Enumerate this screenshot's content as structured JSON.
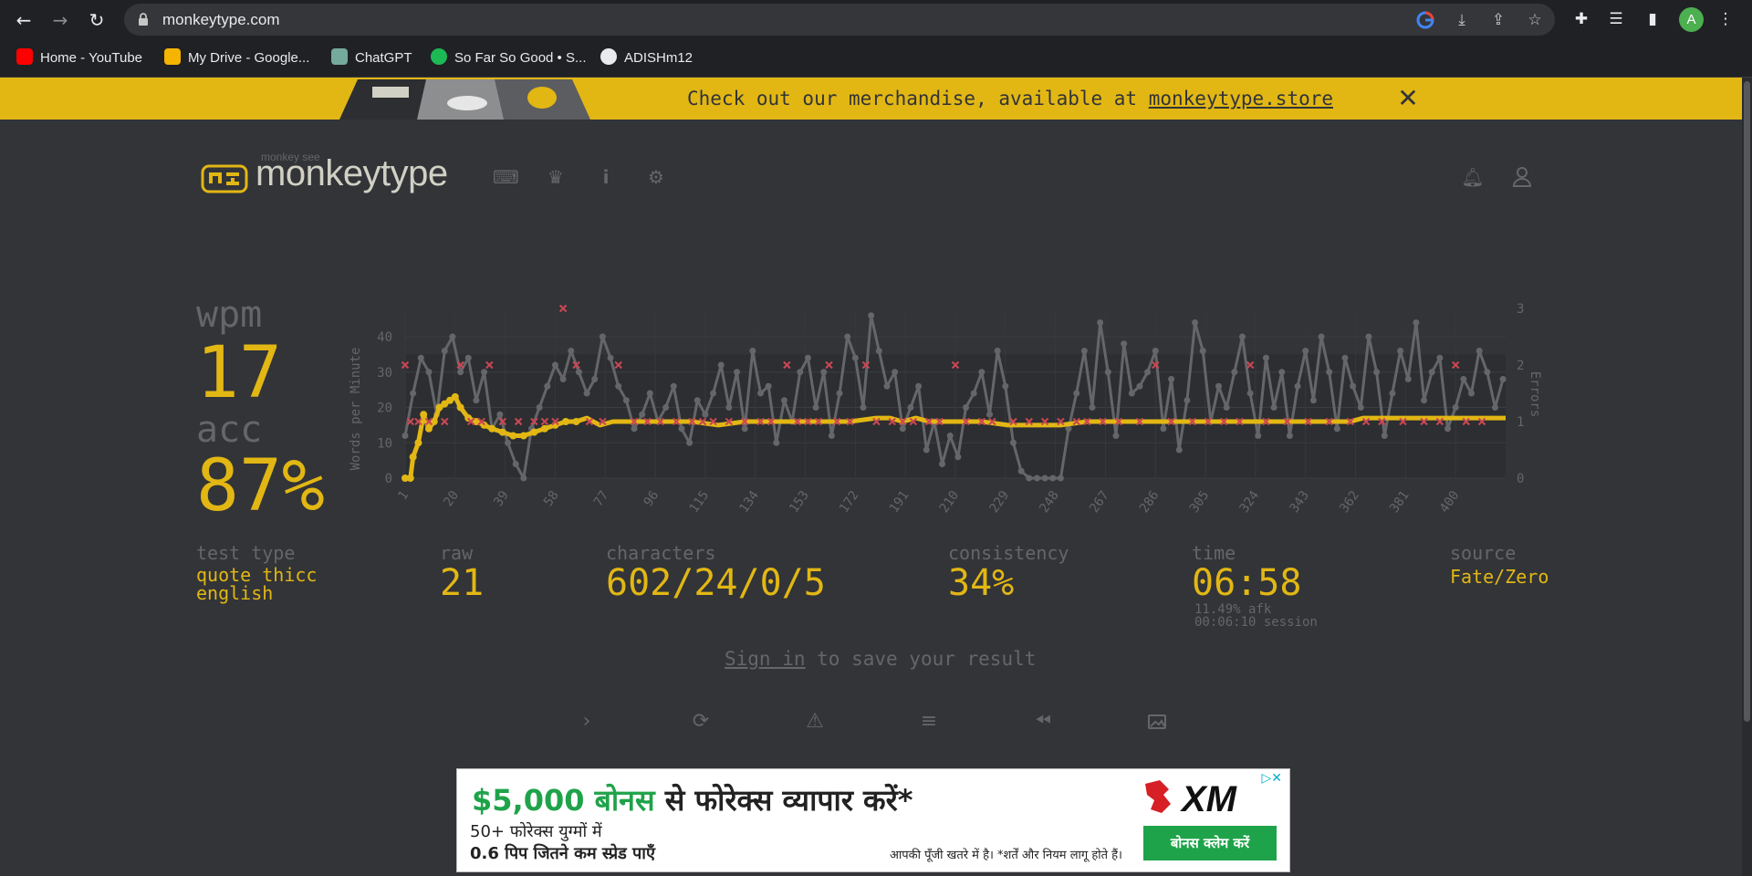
{
  "browser": {
    "url": "monkeytype.com",
    "avatar_letter": "A",
    "bookmarks": [
      {
        "label": "Home - YouTube",
        "color": "#ff0000"
      },
      {
        "label": "My Drive - Google...",
        "color": "#f4b400"
      },
      {
        "label": "ChatGPT",
        "color": "#74aa9c"
      },
      {
        "label": "So Far So Good • S...",
        "color": "#1db954"
      },
      {
        "label": "ADISHm12",
        "color": "#e8eaed"
      }
    ]
  },
  "banner": {
    "message": "Check out our merchandise, available at ",
    "link": "monkeytype.store",
    "color": "#e2b714"
  },
  "header": {
    "logo_small": "monkey see",
    "logo_text": "monkeytype",
    "icons": [
      "keyboard-icon",
      "crown-icon",
      "info-icon",
      "gear-icon",
      "bell-icon",
      "user-icon"
    ]
  },
  "result": {
    "wpm_label": "wpm",
    "wpm": "17",
    "acc_label": "acc",
    "acc": "87%",
    "test_type_label": "test type",
    "test_type_line1": "quote thicc",
    "test_type_line2": "english",
    "raw_label": "raw",
    "raw": "21",
    "characters_label": "characters",
    "characters": "602/24/0/5",
    "consistency_label": "consistency",
    "consistency": "34%",
    "time_label": "time",
    "time": "06:58",
    "afk": "11.49% afk",
    "session": "00:06:10 session",
    "source_label": "source",
    "source": "Fate/Zero"
  },
  "signin": {
    "link": "Sign in",
    "rest": " to save your result"
  },
  "actions": [
    "next-test-icon",
    "restart-icon",
    "warning-icon",
    "words-history-icon",
    "replay-icon",
    "screenshot-icon"
  ],
  "ad": {
    "headline_green": "$5,000 बोनस",
    "headline_rest": " से फोरेक्स व्यापार करें*",
    "sub1": "50+ फोरेक्स युग्मों में",
    "sub2": "0.6 पिप जितने कम स्प्रेड पाएँ",
    "risk": "आपकी पूँजी खतरे में है। *शर्तें और नियम लागू होते हैं।",
    "brand": "XM",
    "cta": "बोनस क्लेम करें"
  },
  "chart_data": {
    "type": "line",
    "ylabel": "Words per Minute",
    "y2label": "Errors",
    "ylim": [
      0,
      48
    ],
    "y2lim": [
      0,
      3
    ],
    "yticks": [
      0,
      10,
      20,
      30,
      40
    ],
    "y2ticks": [
      0,
      1,
      2,
      3
    ],
    "xlim": [
      1,
      419
    ],
    "xticks": [
      1,
      20,
      39,
      58,
      77,
      96,
      115,
      134,
      153,
      172,
      191,
      210,
      229,
      248,
      267,
      286,
      305,
      324,
      343,
      362,
      381,
      400
    ],
    "series": [
      {
        "role": "raw",
        "color": "#646669",
        "points": [
          [
            1,
            12
          ],
          [
            4,
            24
          ],
          [
            7,
            34
          ],
          [
            10,
            30
          ],
          [
            13,
            18
          ],
          [
            16,
            36
          ],
          [
            19,
            40
          ],
          [
            22,
            30
          ],
          [
            25,
            34
          ],
          [
            28,
            22
          ],
          [
            31,
            30
          ],
          [
            34,
            14
          ],
          [
            37,
            18
          ],
          [
            40,
            10
          ],
          [
            43,
            4
          ],
          [
            46,
            0
          ],
          [
            49,
            14
          ],
          [
            52,
            20
          ],
          [
            55,
            26
          ],
          [
            58,
            32
          ],
          [
            61,
            28
          ],
          [
            64,
            36
          ],
          [
            67,
            30
          ],
          [
            70,
            24
          ],
          [
            73,
            28
          ],
          [
            76,
            40
          ],
          [
            79,
            34
          ],
          [
            82,
            26
          ],
          [
            85,
            22
          ],
          [
            88,
            14
          ],
          [
            91,
            18
          ],
          [
            94,
            24
          ],
          [
            97,
            16
          ],
          [
            100,
            20
          ],
          [
            103,
            26
          ],
          [
            106,
            14
          ],
          [
            109,
            10
          ],
          [
            112,
            22
          ],
          [
            115,
            18
          ],
          [
            118,
            24
          ],
          [
            121,
            32
          ],
          [
            124,
            20
          ],
          [
            127,
            30
          ],
          [
            130,
            14
          ],
          [
            133,
            36
          ],
          [
            136,
            24
          ],
          [
            139,
            26
          ],
          [
            142,
            10
          ],
          [
            145,
            22
          ],
          [
            148,
            16
          ],
          [
            151,
            30
          ],
          [
            154,
            34
          ],
          [
            157,
            20
          ],
          [
            160,
            30
          ],
          [
            163,
            12
          ],
          [
            166,
            24
          ],
          [
            169,
            40
          ],
          [
            172,
            34
          ],
          [
            175,
            20
          ],
          [
            178,
            46
          ],
          [
            181,
            36
          ],
          [
            184,
            26
          ],
          [
            187,
            30
          ],
          [
            190,
            14
          ],
          [
            193,
            20
          ],
          [
            196,
            26
          ],
          [
            199,
            8
          ],
          [
            202,
            16
          ],
          [
            205,
            4
          ],
          [
            208,
            12
          ],
          [
            211,
            6
          ],
          [
            214,
            20
          ],
          [
            217,
            24
          ],
          [
            220,
            30
          ],
          [
            223,
            18
          ],
          [
            226,
            36
          ],
          [
            229,
            26
          ],
          [
            232,
            10
          ],
          [
            235,
            2
          ],
          [
            238,
            0
          ],
          [
            241,
            0
          ],
          [
            244,
            0
          ],
          [
            247,
            0
          ],
          [
            250,
            0
          ],
          [
            253,
            14
          ],
          [
            256,
            24
          ],
          [
            259,
            36
          ],
          [
            262,
            20
          ],
          [
            265,
            44
          ],
          [
            268,
            30
          ],
          [
            271,
            12
          ],
          [
            274,
            38
          ],
          [
            277,
            24
          ],
          [
            280,
            26
          ],
          [
            283,
            30
          ],
          [
            286,
            36
          ],
          [
            289,
            14
          ],
          [
            292,
            28
          ],
          [
            295,
            8
          ],
          [
            298,
            22
          ],
          [
            301,
            44
          ],
          [
            304,
            36
          ],
          [
            307,
            16
          ],
          [
            310,
            26
          ],
          [
            313,
            20
          ],
          [
            316,
            30
          ],
          [
            319,
            40
          ],
          [
            322,
            24
          ],
          [
            325,
            12
          ],
          [
            328,
            34
          ],
          [
            331,
            20
          ],
          [
            334,
            30
          ],
          [
            337,
            12
          ],
          [
            340,
            26
          ],
          [
            343,
            36
          ],
          [
            346,
            22
          ],
          [
            349,
            40
          ],
          [
            352,
            30
          ],
          [
            355,
            14
          ],
          [
            358,
            34
          ],
          [
            361,
            26
          ],
          [
            364,
            20
          ],
          [
            367,
            40
          ],
          [
            370,
            30
          ],
          [
            373,
            12
          ],
          [
            376,
            24
          ],
          [
            379,
            36
          ],
          [
            382,
            28
          ],
          [
            385,
            44
          ],
          [
            388,
            22
          ],
          [
            391,
            30
          ],
          [
            394,
            34
          ],
          [
            397,
            14
          ],
          [
            400,
            20
          ],
          [
            403,
            28
          ],
          [
            406,
            24
          ],
          [
            409,
            36
          ],
          [
            412,
            30
          ],
          [
            415,
            20
          ],
          [
            418,
            28
          ]
        ]
      },
      {
        "role": "wpm",
        "color": "#e2b714",
        "points": [
          [
            1,
            0
          ],
          [
            3,
            0
          ],
          [
            4,
            6
          ],
          [
            6,
            10
          ],
          [
            8,
            18
          ],
          [
            10,
            14
          ],
          [
            12,
            16
          ],
          [
            14,
            20
          ],
          [
            16,
            21
          ],
          [
            18,
            22
          ],
          [
            20,
            23
          ],
          [
            22,
            20
          ],
          [
            25,
            17
          ],
          [
            28,
            16
          ],
          [
            31,
            15
          ],
          [
            34,
            14
          ],
          [
            38,
            13
          ],
          [
            42,
            12
          ],
          [
            46,
            12
          ],
          [
            50,
            13
          ],
          [
            54,
            14
          ],
          [
            58,
            15
          ],
          [
            62,
            16
          ],
          [
            66,
            16
          ],
          [
            70,
            17
          ],
          [
            75,
            15
          ],
          [
            80,
            16
          ],
          [
            90,
            16
          ],
          [
            100,
            16
          ],
          [
            110,
            16
          ],
          [
            120,
            15
          ],
          [
            130,
            16
          ],
          [
            140,
            16
          ],
          [
            150,
            16
          ],
          [
            160,
            16
          ],
          [
            170,
            16
          ],
          [
            180,
            17
          ],
          [
            185,
            17
          ],
          [
            190,
            16
          ],
          [
            195,
            17
          ],
          [
            200,
            16
          ],
          [
            210,
            16
          ],
          [
            220,
            16
          ],
          [
            230,
            15
          ],
          [
            240,
            15
          ],
          [
            250,
            15
          ],
          [
            260,
            16
          ],
          [
            270,
            16
          ],
          [
            280,
            16
          ],
          [
            290,
            16
          ],
          [
            300,
            16
          ],
          [
            310,
            16
          ],
          [
            320,
            16
          ],
          [
            330,
            16
          ],
          [
            340,
            16
          ],
          [
            350,
            16
          ],
          [
            360,
            16
          ],
          [
            365,
            17
          ],
          [
            370,
            17
          ],
          [
            380,
            17
          ],
          [
            390,
            17
          ],
          [
            400,
            17
          ],
          [
            410,
            17
          ],
          [
            419,
            17
          ]
        ]
      },
      {
        "role": "errors",
        "color": "#ca4754",
        "points": [
          [
            1,
            2
          ],
          [
            3,
            1
          ],
          [
            6,
            1
          ],
          [
            10,
            1
          ],
          [
            16,
            1
          ],
          [
            22,
            2
          ],
          [
            26,
            1
          ],
          [
            30,
            1
          ],
          [
            33,
            2
          ],
          [
            38,
            1
          ],
          [
            44,
            1
          ],
          [
            50,
            1
          ],
          [
            54,
            1
          ],
          [
            58,
            1
          ],
          [
            61,
            3
          ],
          [
            66,
            2
          ],
          [
            71,
            1
          ],
          [
            76,
            1
          ],
          [
            82,
            2
          ],
          [
            88,
            1
          ],
          [
            93,
            1
          ],
          [
            98,
            1
          ],
          [
            104,
            1
          ],
          [
            110,
            1
          ],
          [
            114,
            1
          ],
          [
            118,
            1
          ],
          [
            124,
            1
          ],
          [
            130,
            1
          ],
          [
            136,
            1
          ],
          [
            140,
            1
          ],
          [
            146,
            2
          ],
          [
            150,
            1
          ],
          [
            154,
            1
          ],
          [
            158,
            1
          ],
          [
            162,
            2
          ],
          [
            165,
            1
          ],
          [
            170,
            1
          ],
          [
            176,
            2
          ],
          [
            180,
            1
          ],
          [
            186,
            1
          ],
          [
            190,
            1
          ],
          [
            194,
            1
          ],
          [
            200,
            1
          ],
          [
            204,
            1
          ],
          [
            210,
            2
          ],
          [
            214,
            1
          ],
          [
            220,
            1
          ],
          [
            224,
            1
          ],
          [
            232,
            1
          ],
          [
            238,
            1
          ],
          [
            244,
            1
          ],
          [
            250,
            1
          ],
          [
            256,
            1
          ],
          [
            260,
            1
          ],
          [
            266,
            1
          ],
          [
            272,
            1
          ],
          [
            280,
            1
          ],
          [
            286,
            2
          ],
          [
            292,
            1
          ],
          [
            300,
            1
          ],
          [
            306,
            1
          ],
          [
            312,
            1
          ],
          [
            318,
            1
          ],
          [
            322,
            2
          ],
          [
            328,
            1
          ],
          [
            336,
            1
          ],
          [
            344,
            1
          ],
          [
            352,
            1
          ],
          [
            360,
            1
          ],
          [
            366,
            1
          ],
          [
            372,
            1
          ],
          [
            380,
            1
          ],
          [
            388,
            1
          ],
          [
            394,
            1
          ],
          [
            400,
            2
          ],
          [
            404,
            1
          ],
          [
            410,
            1
          ]
        ]
      }
    ]
  }
}
